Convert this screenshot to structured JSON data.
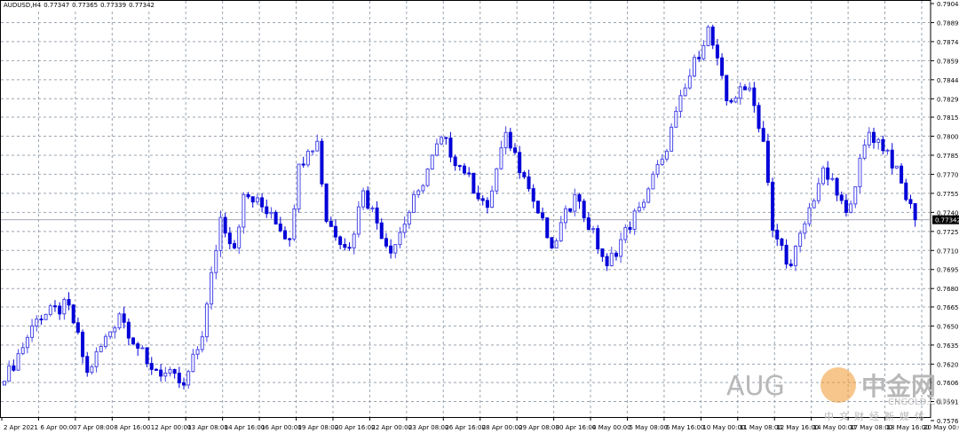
{
  "header": {
    "symbol": "AUDUSD,H4",
    "open": "0.77347",
    "high": "0.77365",
    "low": "0.77339",
    "close": "0.77342"
  },
  "watermark": {
    "left": "AUG",
    "brand": "中金网",
    "site": "CNGOLD.COM",
    "slogan": "中文财经新媒体"
  },
  "colors": {
    "bull": "#4848e8",
    "bear": "#0000d8",
    "grid": "#9aa4b0",
    "price_line": "#a8acb4"
  },
  "chart_data": {
    "type": "candlestick",
    "title": "AUDUSD,H4",
    "ylim": [
      0.7576,
      0.79045
    ],
    "current_price": "0.77342",
    "ytick_labels": [
      "0.79045",
      "0.78895",
      "0.78745",
      "0.78595",
      "0.78445",
      "0.78295",
      "0.78150",
      "0.78000",
      "0.77850",
      "0.77700",
      "0.77550",
      "0.77400",
      "0.77250",
      "0.77100",
      "0.76950",
      "0.76800",
      "0.76655",
      "0.76505",
      "0.76355",
      "0.76205",
      "0.76060",
      "0.75910",
      "0.75760"
    ],
    "xtick_labels": [
      "2 Apr 2021",
      "6 Apr 00:00",
      "7 Apr 08:00",
      "8 Apr 16:00",
      "12 Apr 00:00",
      "13 Apr 08:00",
      "14 Apr 16:00",
      "16 Apr 00:00",
      "19 Apr 08:00",
      "20 Apr 16:00",
      "22 Apr 00:00",
      "23 Apr 08:00",
      "26 Apr 16:00",
      "28 Apr 00:00",
      "29 Apr 08:00",
      "30 Apr 16:00",
      "4 May 00:00",
      "5 May 08:00",
      "6 May 16:00",
      "10 May 00:00",
      "11 May 08:00",
      "12 May 16:00",
      "14 May 00:00",
      "17 May 08:00",
      "18 May 16:00",
      "20 May 00:00"
    ],
    "bars_per_xtick": 8,
    "bar_count": 199,
    "close_path": [
      [
        0,
        0.7607
      ],
      [
        7,
        0.7656
      ],
      [
        14,
        0.7667
      ],
      [
        18,
        0.7614
      ],
      [
        25,
        0.766
      ],
      [
        31,
        0.7621
      ],
      [
        39,
        0.7604
      ],
      [
        43,
        0.7642
      ],
      [
        47,
        0.7736
      ],
      [
        50,
        0.7712
      ],
      [
        52,
        0.7754
      ],
      [
        58,
        0.774
      ],
      [
        62,
        0.7719
      ],
      [
        64,
        0.7778
      ],
      [
        68,
        0.7796
      ],
      [
        70,
        0.7733
      ],
      [
        75,
        0.7712
      ],
      [
        78,
        0.7757
      ],
      [
        84,
        0.7708
      ],
      [
        90,
        0.7757
      ],
      [
        95,
        0.7799
      ],
      [
        100,
        0.7771
      ],
      [
        105,
        0.7744
      ],
      [
        109,
        0.7803
      ],
      [
        113,
        0.7768
      ],
      [
        119,
        0.7712
      ],
      [
        124,
        0.7754
      ],
      [
        131,
        0.7698
      ],
      [
        138,
        0.7744
      ],
      [
        143,
        0.7782
      ],
      [
        148,
        0.7838
      ],
      [
        153,
        0.7886
      ],
      [
        157,
        0.7828
      ],
      [
        162,
        0.7838
      ],
      [
        165,
        0.7796
      ],
      [
        167,
        0.7726
      ],
      [
        171,
        0.7698
      ],
      [
        178,
        0.7775
      ],
      [
        183,
        0.774
      ],
      [
        188,
        0.7803
      ],
      [
        192,
        0.7789
      ],
      [
        198,
        0.77342
      ]
    ]
  }
}
